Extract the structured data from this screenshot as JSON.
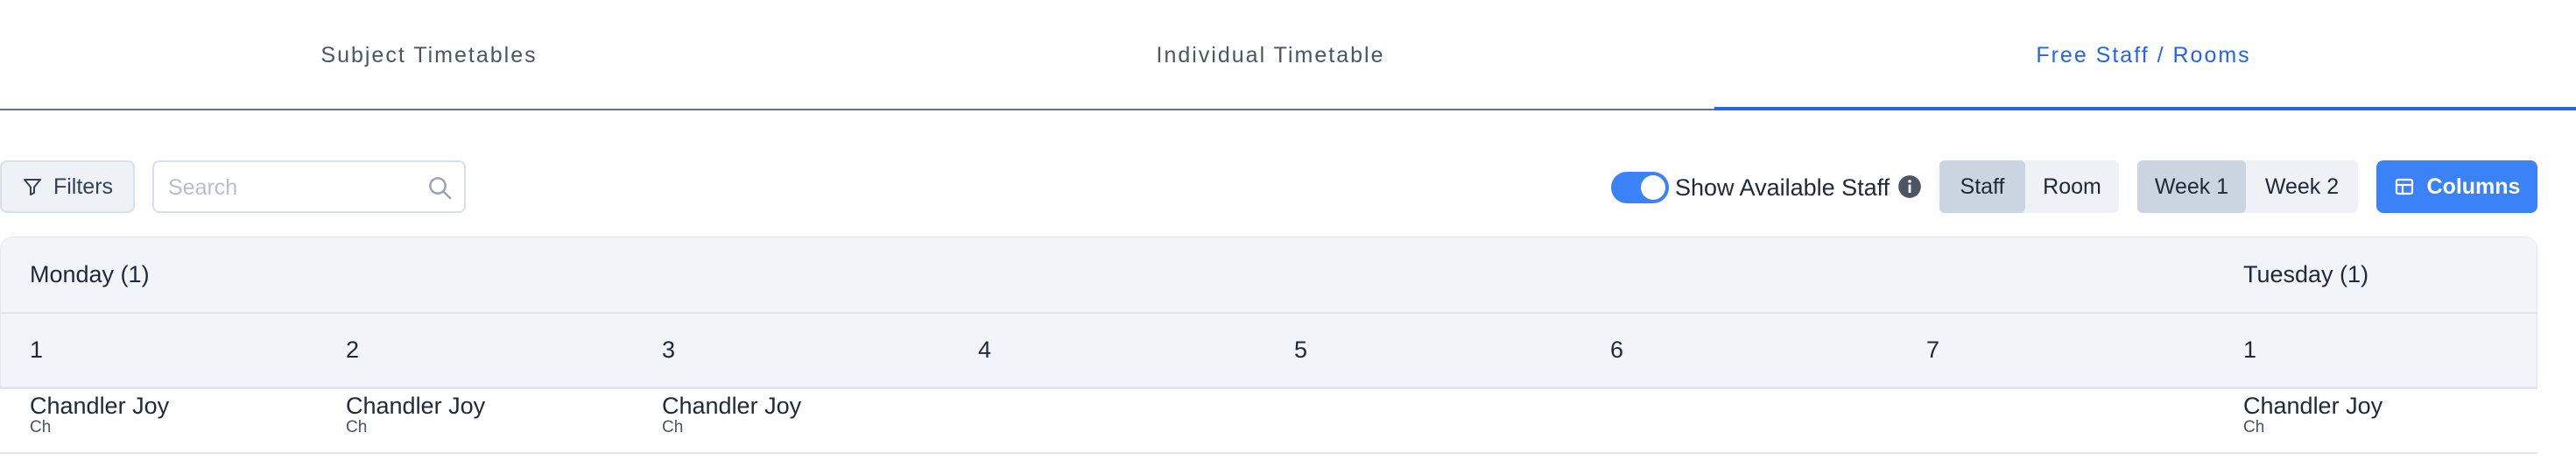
{
  "tabs": [
    {
      "label": "Subject Timetables"
    },
    {
      "label": "Individual Timetable"
    },
    {
      "label": "Free Staff / Rooms"
    }
  ],
  "toolbar": {
    "filters_label": "Filters",
    "search_placeholder": "Search",
    "search_value": "",
    "toggle_label": "Show Available Staff",
    "toggle_on": true,
    "staff_room": [
      "Staff",
      "Room"
    ],
    "selected_staff_room": "Staff",
    "weeks": [
      "Week 1",
      "Week 2"
    ],
    "selected_week": "Week 1",
    "columns_label": "Columns"
  },
  "grid": {
    "days": [
      {
        "label": "Monday (1)"
      },
      {
        "label": "Tuesday (1)"
      }
    ],
    "periods": [
      "1",
      "2",
      "3",
      "4",
      "5",
      "6",
      "7",
      "1"
    ],
    "cells": [
      {
        "name": "Chandler Joy",
        "code": "Ch"
      },
      {
        "name": "Chandler Joy",
        "code": "Ch"
      },
      {
        "name": "Chandler Joy",
        "code": "Ch"
      },
      {
        "name": "Chandler Joy",
        "code": "Ch"
      }
    ]
  },
  "colors": {
    "accent": "#2563eb",
    "button": "#3b82f6",
    "header_bg": "#f1f4f8"
  }
}
